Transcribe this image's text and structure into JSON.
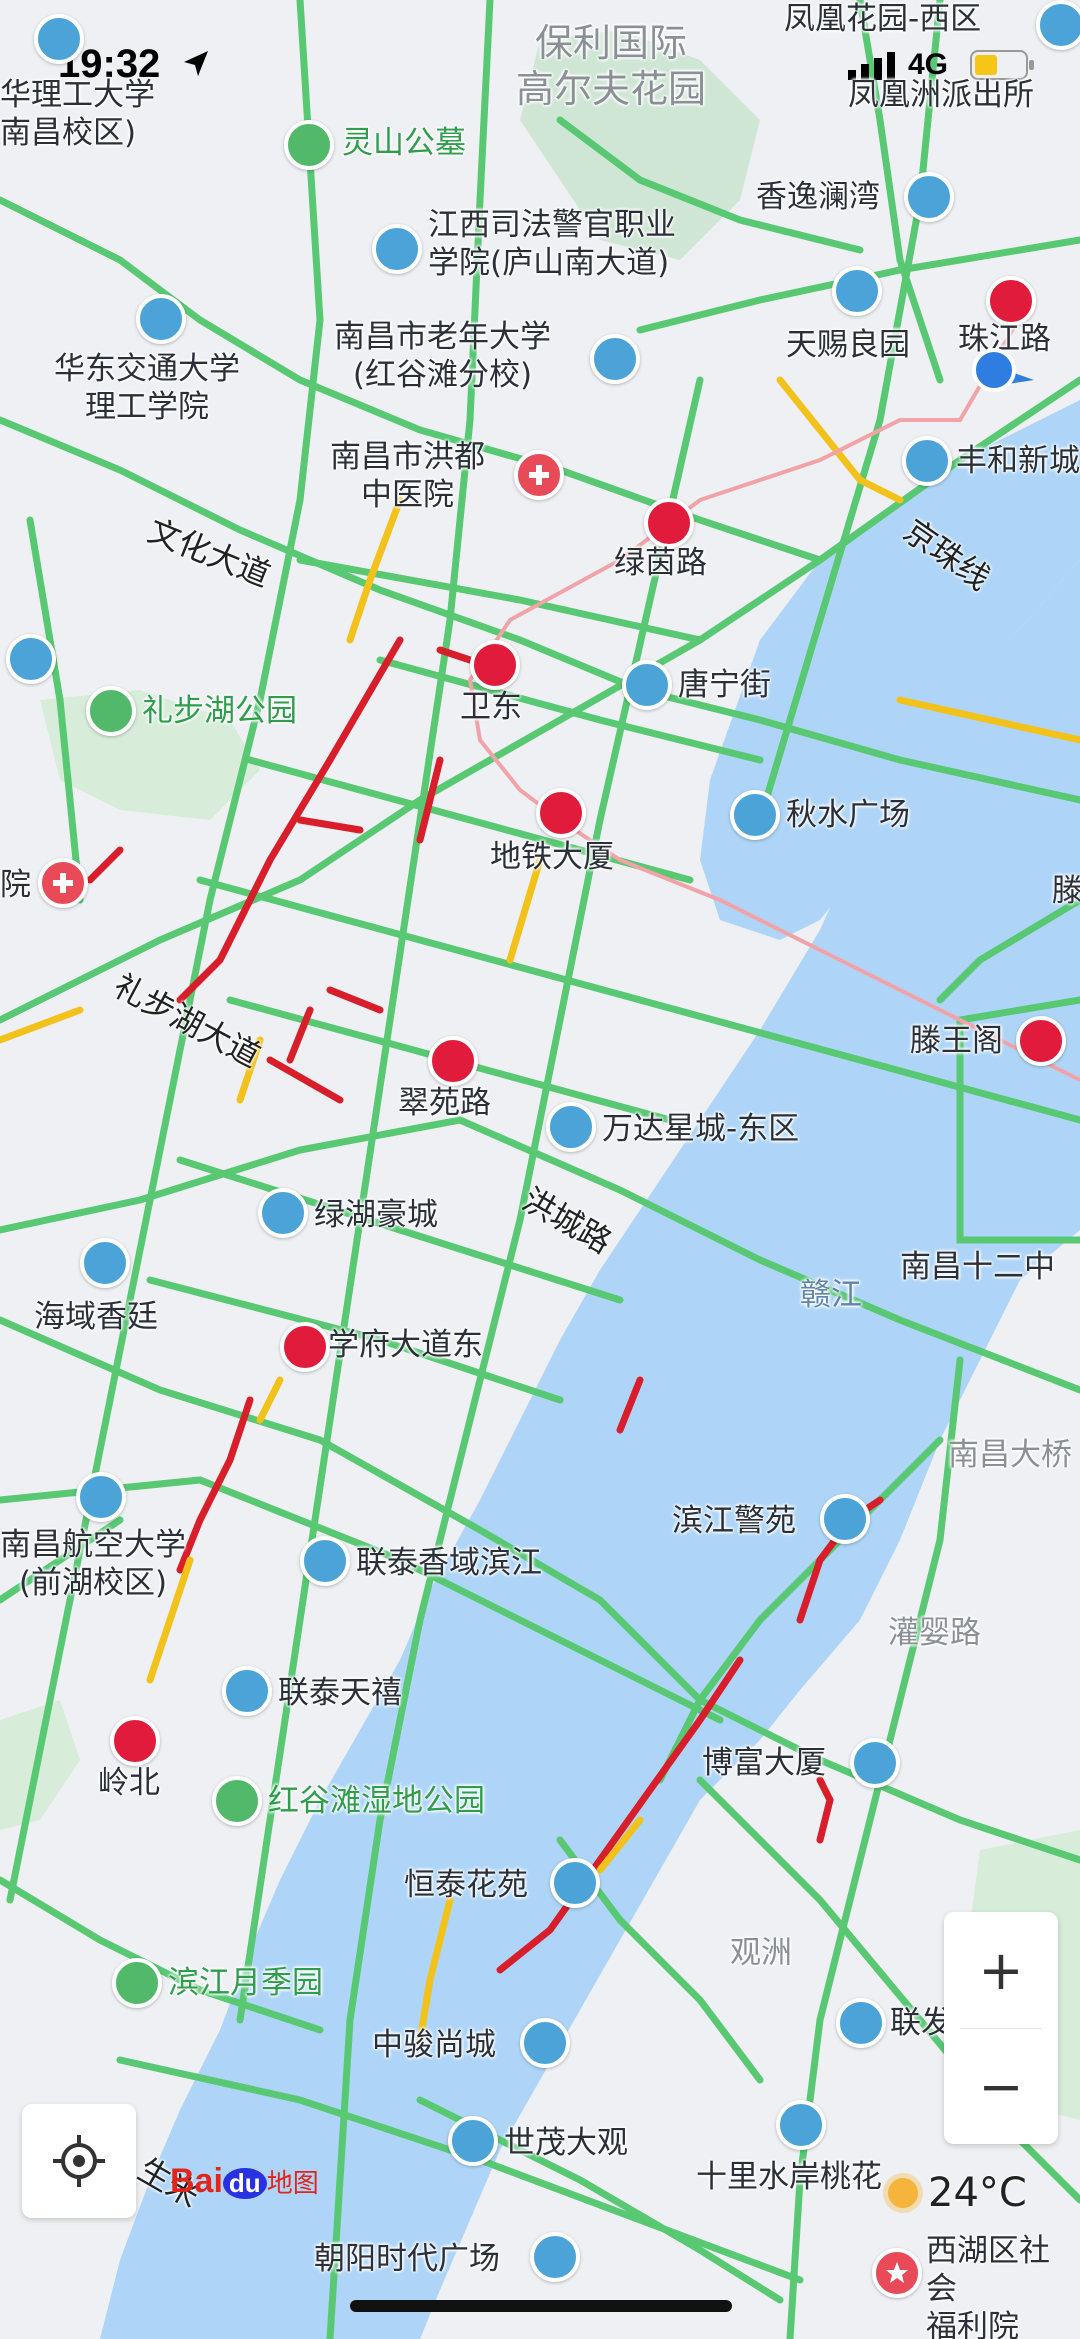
{
  "status_bar": {
    "time": "19:32",
    "network": "4G"
  },
  "map_labels": {
    "poly_golf": "保利国际\n高尔夫花园",
    "fenghuang_west": "凤凰花园-西区",
    "fenghuang_police": "凤凰洲派出所",
    "ecjtu_nanchang": "华理工大学\n南昌校区)",
    "lingshan": "灵山公墓",
    "jx_justice": "江西司法警官职业\n学院(庐山南大道)",
    "xiangyi": "香逸澜湾",
    "tianci": "天赐良园",
    "zhujiang_rd": "珠江路",
    "ecjtu_sci": "华东交通大学\n理工学院",
    "elder_univ": "南昌市老年大学\n(红谷滩分校)",
    "fenghe": "丰和新城",
    "hongdu_hosp": "南昌市洪都\n中医院",
    "lvyin_rd": "绿茵路",
    "weidong": "卫东",
    "tangning": "唐宁街",
    "libuhu_park": "礼步湖公园",
    "metro_bldg": "地铁大厦",
    "qiushui": "秋水广场",
    "hospital_left": "院",
    "tengwang": "滕王阁",
    "tengwang_partial": "滕",
    "cuiyuan_rd": "翠苑路",
    "wanda": "万达星城-东区",
    "lvhu": "绿湖豪城",
    "haiyu": "海域香廷",
    "nanchang12": "南昌十二中",
    "ganjiang": "赣江",
    "xuefu": "学府大道东",
    "nanchang_dq": "南昌大桥",
    "hangkong": "南昌航空大学\n(前湖校区)",
    "liantai_xy": "联泰香域滨江",
    "binjiang_jy": "滨江警苑",
    "guanying_rd": "灌婴路",
    "liantai_tx": "联泰天禧",
    "lingbei": "岭北",
    "honggutan_park": "红谷滩湿地公园",
    "bofu": "博富大厦",
    "hengtai": "恒泰花苑",
    "guanzhou": "观洲",
    "binjiang_yjy": "滨江月季园",
    "lianfa": "联发",
    "zhongjun": "中骏尚城",
    "shimao": "世茂大观",
    "shili": "十里水岸桃花",
    "chaoyang": "朝阳时代广场",
    "xihu_welfare": "西湖区社会\n福利院"
  },
  "road_labels": {
    "wenhua": "文化大道",
    "jingzhu": "京珠线",
    "libuhu_ave": "礼步湖大道",
    "hongcheng": "洪城路",
    "shengmi": "生米"
  },
  "controls": {
    "zoom_in": "+",
    "zoom_out": "−"
  },
  "logo": {
    "bai": "Bai",
    "du": "du",
    "map": "地图"
  },
  "weather": {
    "temp": "24°C"
  },
  "colors": {
    "road_green": "#58c873",
    "road_red": "#d81e2a",
    "road_yellow": "#f2c21b",
    "water": "#aed5f7",
    "metro_line": "#f1a3a8"
  }
}
